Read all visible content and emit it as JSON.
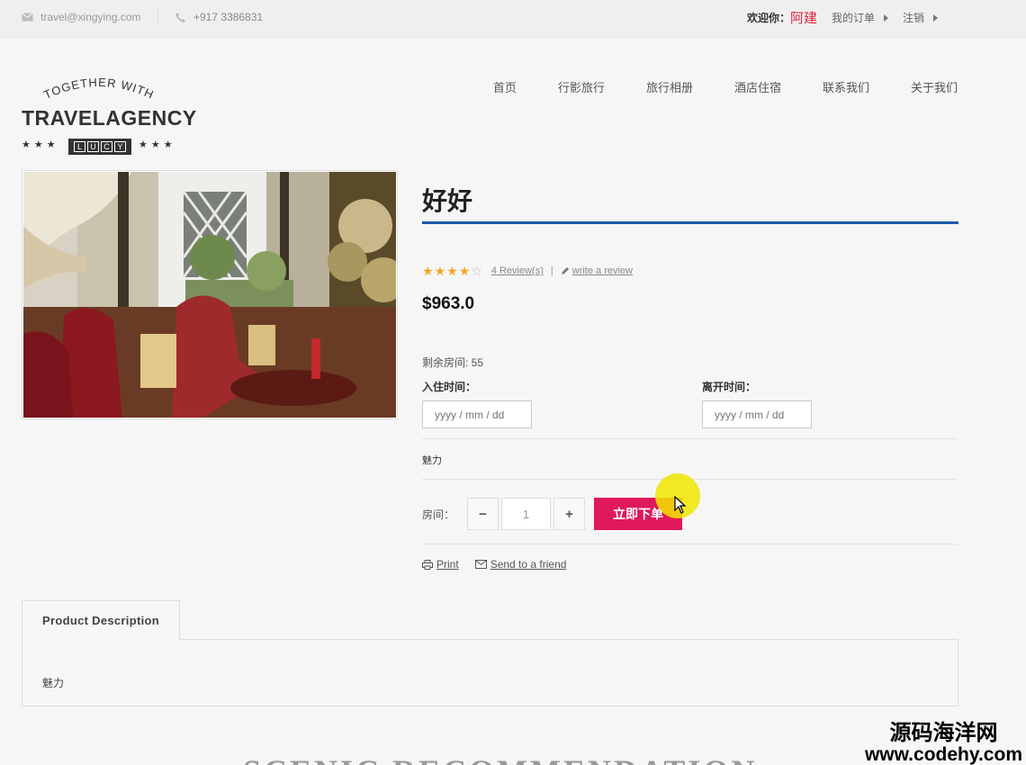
{
  "topbar": {
    "email": "travel@xingying.com",
    "phone": "+917 3386831",
    "welcome": "欢迎你：",
    "username": "阿建",
    "orders": "我的订单",
    "logout": "注销"
  },
  "logo": {
    "arc_text": "TOGETHER WITH",
    "main_text": "TRAVELAGENCY",
    "badge_text": [
      "L",
      "U",
      "C",
      "Y"
    ],
    "stars": "★★★"
  },
  "nav": [
    "首页",
    "行影旅行",
    "旅行相册",
    "酒店住宿",
    "联系我们",
    "关于我们"
  ],
  "product": {
    "title": "好好",
    "rating": 4,
    "rating_max": 5,
    "reviews_link": "4 Review(s)",
    "write_review": "write a review",
    "price": "$963.0",
    "rooms_left": "剩余房间: 55",
    "checkin_label": "入住时间：",
    "checkout_label": "离开时间：",
    "date_placeholder": "yyyy / mm / dd",
    "charm": "魅力",
    "qty_label": "房间：",
    "qty_minus": "−",
    "qty_value": "1",
    "qty_plus": "+",
    "order_button": "立即下单",
    "print_link": "Print",
    "send_link": "Send to a friend"
  },
  "tabs": {
    "active_tab": "Product Description",
    "body": "魅力"
  },
  "section_heading": "SCENIC RECOMMENDATION",
  "watermark": {
    "cn": "源码海洋网",
    "en": "www.codehy.com"
  },
  "colors": {
    "accent_blue": "#1c5aa8",
    "order_pink": "#e0195a",
    "username_red": "#d9233e",
    "star_orange": "#f5a623"
  }
}
